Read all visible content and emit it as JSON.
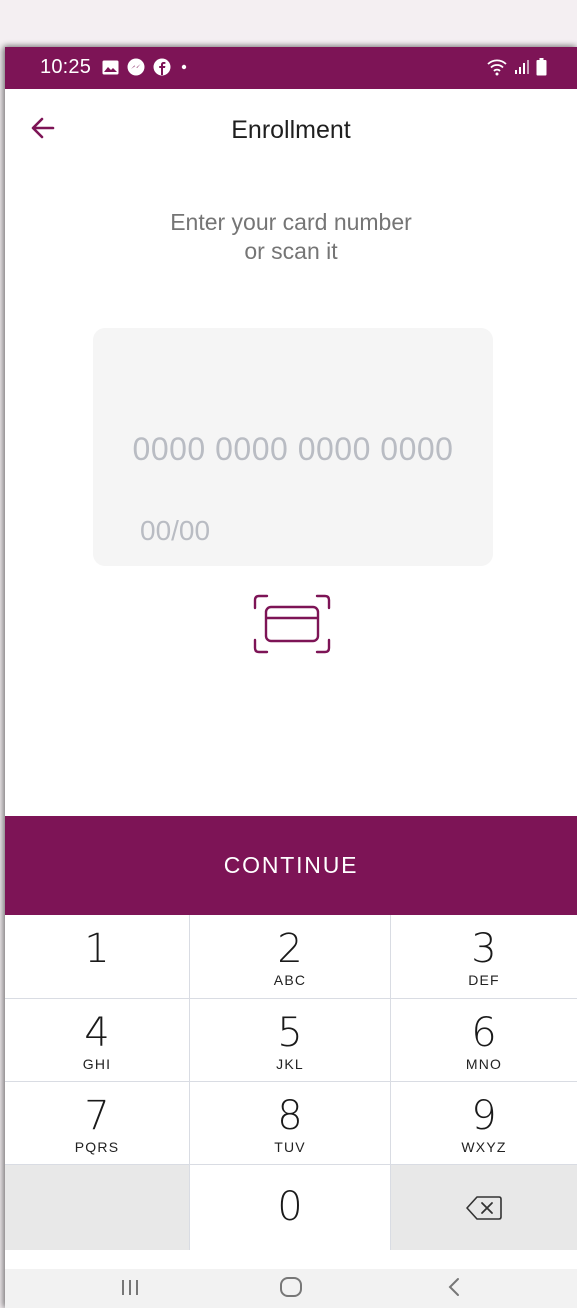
{
  "status_bar": {
    "time": "10:25",
    "left_icons": [
      "image-icon",
      "messenger-icon",
      "facebook-icon",
      "dot-icon"
    ],
    "right_icons": [
      "wifi-icon",
      "signal-icon",
      "battery-icon"
    ]
  },
  "header": {
    "title": "Enrollment",
    "back_icon": "arrow-left-icon"
  },
  "main": {
    "instruction_line1": "Enter your card number",
    "instruction_line2": "or scan it",
    "card_number_placeholder": "0000 0000 0000 0000",
    "expiry_placeholder": "00/00",
    "scan_icon": "card-scan-icon"
  },
  "continue_label": "CONTINUE",
  "keypad": {
    "keys": [
      {
        "digit": "1",
        "letters": ""
      },
      {
        "digit": "2",
        "letters": "ABC"
      },
      {
        "digit": "3",
        "letters": "DEF"
      },
      {
        "digit": "4",
        "letters": "GHI"
      },
      {
        "digit": "5",
        "letters": "JKL"
      },
      {
        "digit": "6",
        "letters": "MNO"
      },
      {
        "digit": "7",
        "letters": "PQRS"
      },
      {
        "digit": "8",
        "letters": "TUV"
      },
      {
        "digit": "9",
        "letters": "WXYZ"
      },
      {
        "digit": "0",
        "letters": ""
      }
    ],
    "backspace_icon": "backspace-icon"
  },
  "nav_bar": {
    "icons": [
      "recent-apps-icon",
      "home-icon",
      "back-nav-icon"
    ]
  },
  "colors": {
    "brand": "#7d1456",
    "placeholder": "#b9bcc3",
    "instruction_text": "#757575"
  }
}
